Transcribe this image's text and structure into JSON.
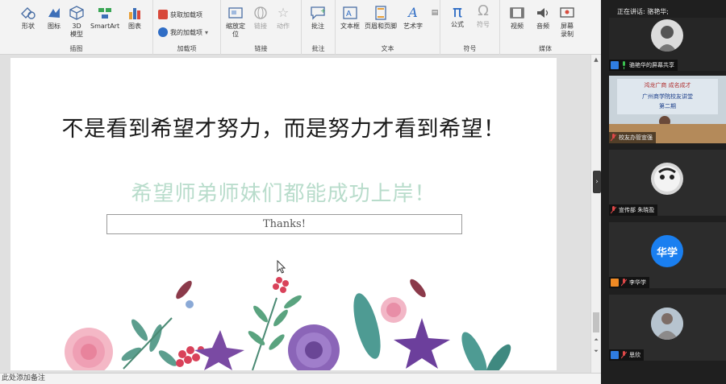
{
  "ribbon": {
    "buttons": {
      "shapes": "形状",
      "icons": "图标",
      "model3d_line1": "3D",
      "model3d_line2": "模型",
      "smartart": "SmartArt",
      "chart": "图表",
      "get_addins": "获取加载项",
      "my_addins": "我的加载项",
      "zoom_line1": "缩放定",
      "zoom_line2": "位",
      "link": "链接",
      "action": "动作",
      "comment": "批注",
      "textbox": "文本框",
      "header_footer": "页眉和页脚",
      "wordart": "艺术字",
      "equation": "公式",
      "symbol": "符号",
      "video": "视频",
      "audio": "音频",
      "screen_rec_line1": "屏幕",
      "screen_rec_line2": "录制"
    },
    "groups": {
      "illustrations": "插图",
      "addins": "加载项",
      "links": "链接",
      "comments": "批注",
      "text": "文本",
      "symbols": "符号",
      "media": "媒体"
    }
  },
  "slide": {
    "main_quote": "不是看到希望才努力，而是努力才看到希望！",
    "sub_quote": "希望师弟师妹们都能成功上岸！",
    "thanks": "Thanks!"
  },
  "notes_placeholder": "此处添加备注",
  "meeting": {
    "speaking_label": "正在讲话: 骆艳华;",
    "tiles": [
      {
        "name": "骆艳华的屏幕共享",
        "icon": "screen-share-icon"
      },
      {
        "name": "校友办管宣强",
        "icon": "video-camera-icon",
        "banner_line1": "鸿龙广商  成名成才",
        "banner_line2": "广州商学院校友讲堂",
        "banner_line3": "第二期"
      },
      {
        "name": "宣传部 朱晓盈",
        "icon": "video-camera-icon"
      },
      {
        "name": "李华学",
        "icon": "user-icon",
        "initials": "华学"
      },
      {
        "name": "思欣",
        "icon": "user-icon"
      }
    ]
  },
  "colors": {
    "sub_quote": "#b8dccb",
    "accent_blue": "#1a7ff0",
    "panel_bg": "#1f1f1f"
  }
}
